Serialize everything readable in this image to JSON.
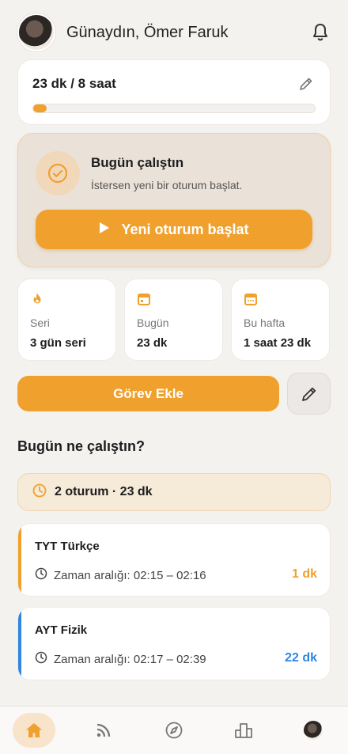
{
  "header": {
    "greeting": "Günaydın, Ömer Faruk",
    "avatar_icon": "user-avatar",
    "bell_icon": "bell-icon"
  },
  "goal": {
    "text": "23 dk / 8 saat",
    "progress_fraction": 0.048,
    "edit_icon": "pencil-icon"
  },
  "today": {
    "title": "Bugün çalıştın",
    "subtitle": "İstersen yeni bir oturum başlat.",
    "button_label": "Yeni oturum başlat",
    "check_icon": "check-circle-icon",
    "play_icon": "play-icon"
  },
  "stats": [
    {
      "icon": "flame-icon",
      "label": "Seri",
      "value": "3 gün seri"
    },
    {
      "icon": "calendar-icon",
      "label": "Bugün",
      "value": "23 dk"
    },
    {
      "icon": "calendar-icon",
      "label": "Bu hafta",
      "value": "1 saat 23 dk"
    }
  ],
  "task": {
    "button_label": "Görev Ekle",
    "edit_icon": "pencil-icon"
  },
  "sessions_section": {
    "title": "Bugün ne çalıştın?",
    "summary": "2 oturum · 23 dk",
    "items": [
      {
        "subject": "TYT Türkçe",
        "range": "Zaman aralığı: 02:15 – 02:16",
        "duration": "1 dk",
        "color": "#f0a02d"
      },
      {
        "subject": "AYT Fizik",
        "range": "Zaman aralığı: 02:17 – 02:39",
        "duration": "22 dk",
        "color": "#2f86e0"
      }
    ]
  },
  "colors": {
    "accent": "#f0a02d",
    "blue": "#2f86e0",
    "background": "#f4f2ef"
  },
  "nav": {
    "items": [
      "home-icon",
      "feed-icon",
      "compass-icon",
      "leaderboard-icon",
      "profile-avatar"
    ],
    "active": "home-icon"
  }
}
